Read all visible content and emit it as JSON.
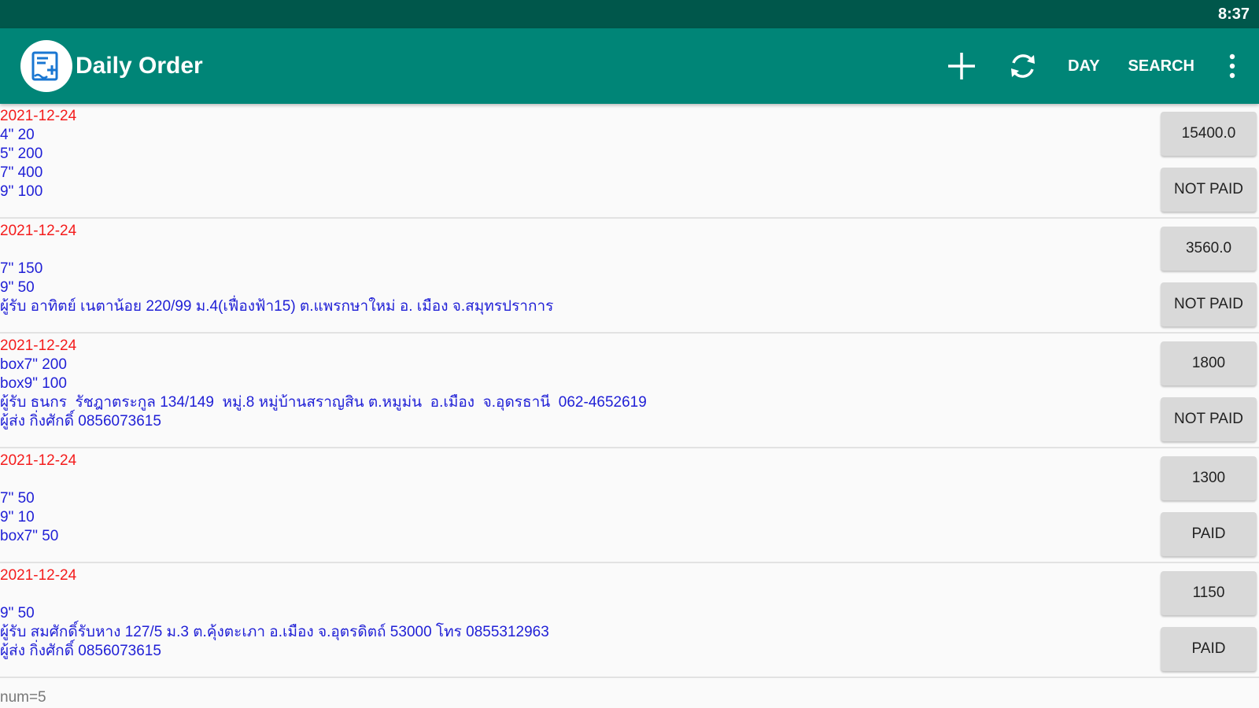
{
  "status_bar": {
    "time": "8:37"
  },
  "app_bar": {
    "title": "Daily Order",
    "day_label": "DAY",
    "search_label": "SEARCH"
  },
  "colors": {
    "primary": "#008577",
    "primary_dark": "#00574b",
    "date_text": "#f41c1c",
    "item_text": "#1f1fd6"
  },
  "orders": [
    {
      "date": "2021-12-24",
      "lines": "4\" 20\n5\" 200\n7\" 400\n9\" 100",
      "amount": "15400.0",
      "status": "NOT PAID"
    },
    {
      "date": "2021-12-24",
      "lines": "\n7\" 150\n9\" 50\nผู้รับ อาทิตย์ เนตาน้อย 220/99 ม.4(เฟื่องฟ้า15) ต.แพรกษาใหม่ อ. เมือง จ.สมุทรปราการ",
      "amount": "3560.0",
      "status": "NOT PAID"
    },
    {
      "date": "2021-12-24",
      "lines": "box7\" 200\nbox9\" 100\nผู้รับ ธนกร  รัชฎาตระกูล 134/149  หมู่.8 หมู่บ้านสราญสิน ต.หมูม่น  อ.เมือง  จ.อุดรธานี  062-4652619\nผู้ส่ง กิ่งศักดิ์ 0856073615",
      "amount": "1800",
      "status": "NOT PAID"
    },
    {
      "date": "2021-12-24",
      "lines": "\n7\" 50\n9\" 10\nbox7\" 50",
      "amount": "1300",
      "status": "PAID"
    },
    {
      "date": "2021-12-24",
      "lines": "\n9\" 50\nผู้รับ สมศักดิ์รับหาง 127/5 ม.3 ต.คุ้งตะเภา อ.เมือง จ.อุตรดิตถ์ 53000 โทร 0855312963\nผู้ส่ง กิ่งศักดิ์ 0856073615",
      "amount": "1150",
      "status": "PAID"
    }
  ],
  "footer": {
    "count_text": "num=5"
  }
}
